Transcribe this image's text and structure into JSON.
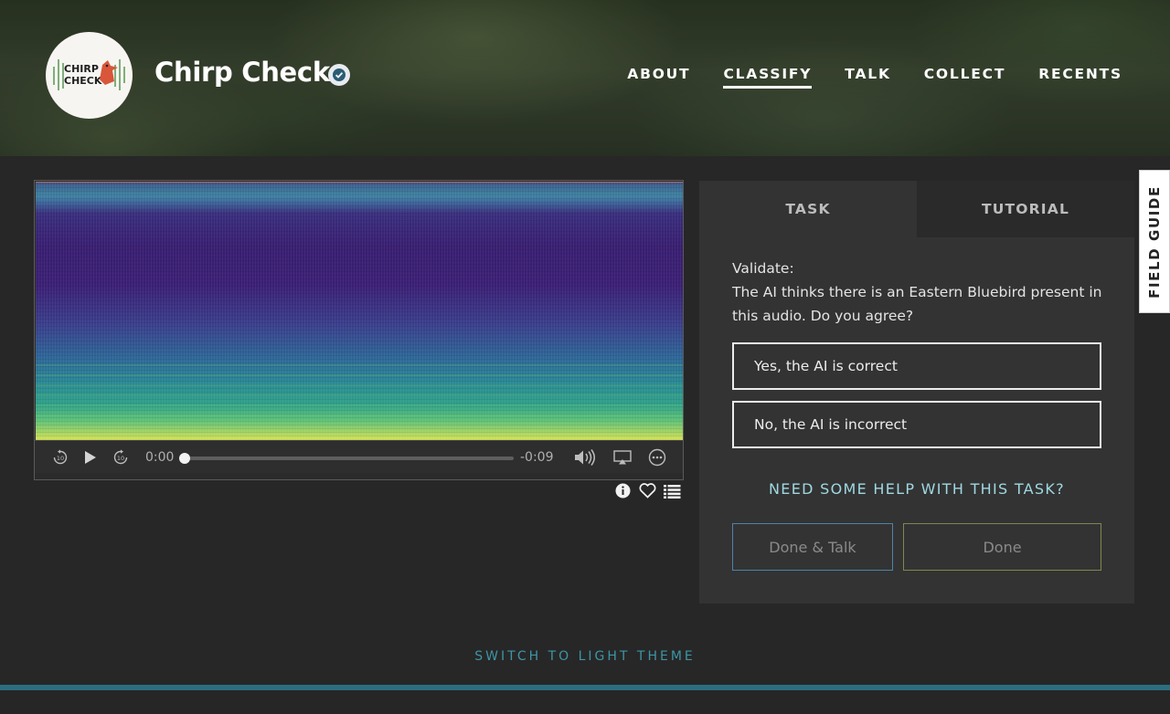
{
  "project": {
    "title": "Chirp Check",
    "logo_text": "CHIRP CHECK"
  },
  "nav": {
    "items": [
      {
        "label": "ABOUT",
        "active": false
      },
      {
        "label": "CLASSIFY",
        "active": true
      },
      {
        "label": "TALK",
        "active": false
      },
      {
        "label": "COLLECT",
        "active": false
      },
      {
        "label": "RECENTS",
        "active": false
      }
    ]
  },
  "player": {
    "current_time": "0:00",
    "remaining_time": "-0:09",
    "progress": 0,
    "skip_seconds": "10"
  },
  "task_panel": {
    "tabs": [
      "TASK",
      "TUTORIAL"
    ],
    "active_tab": "TASK",
    "question_label": "Validate:",
    "question_text": "The AI thinks there is an Eastern Bluebird present in this audio. Do you agree?",
    "answers": [
      "Yes, the AI is correct",
      "No, the AI is incorrect"
    ],
    "help_link": "NEED SOME HELP WITH THIS TASK?",
    "done_talk_label": "Done & Talk",
    "done_label": "Done"
  },
  "field_guide": "FIELD GUIDE",
  "theme_toggle": "SWITCH TO LIGHT THEME",
  "colors": {
    "background": "#272727",
    "panel": "#333333",
    "help_link": "#9fd8e2",
    "accent_teal": "#2b6f7f",
    "done_talk_border": "#4d84a8",
    "done_border": "#7c8a4e"
  }
}
